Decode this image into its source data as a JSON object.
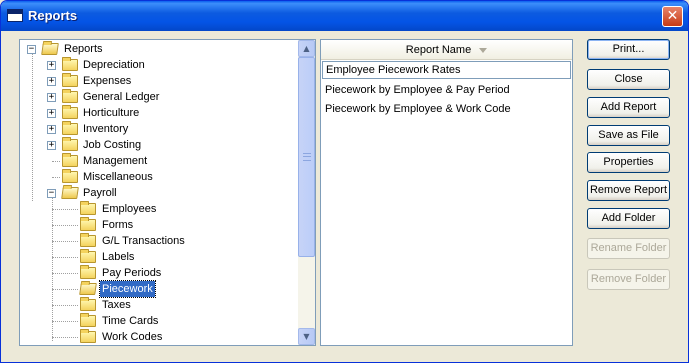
{
  "window": {
    "title": "Reports",
    "close_glyph": "✕"
  },
  "tree": {
    "root": "Reports",
    "items": [
      {
        "label": "Depreciation",
        "expander": "+"
      },
      {
        "label": "Expenses",
        "expander": "+"
      },
      {
        "label": "General Ledger",
        "expander": "+"
      },
      {
        "label": "Horticulture",
        "expander": "+"
      },
      {
        "label": "Inventory",
        "expander": "+"
      },
      {
        "label": "Job Costing",
        "expander": "+"
      },
      {
        "label": "Management",
        "expander": ""
      },
      {
        "label": "Miscellaneous",
        "expander": ""
      },
      {
        "label": "Payroll",
        "expander": "−"
      }
    ],
    "payroll_children": [
      "Employees",
      "Forms",
      "G/L Transactions",
      "Labels",
      "Pay Periods",
      "Piecework",
      "Taxes",
      "Time Cards",
      "Work Codes"
    ],
    "selected": "Piecework",
    "scroll_up": "▲",
    "scroll_down": "▼"
  },
  "list": {
    "header": "Report Name",
    "items": [
      "Employee Piecework Rates",
      "Piecework by Employee & Pay Period",
      "Piecework by Employee & Work Code"
    ]
  },
  "buttons": {
    "print": "Print...",
    "close": "Close",
    "add_report": "Add Report",
    "save_as_file": "Save as File",
    "properties": "Properties",
    "remove_report": "Remove Report",
    "add_folder": "Add Folder",
    "rename_folder": "Rename Folder",
    "remove_folder": "Remove Folder"
  }
}
